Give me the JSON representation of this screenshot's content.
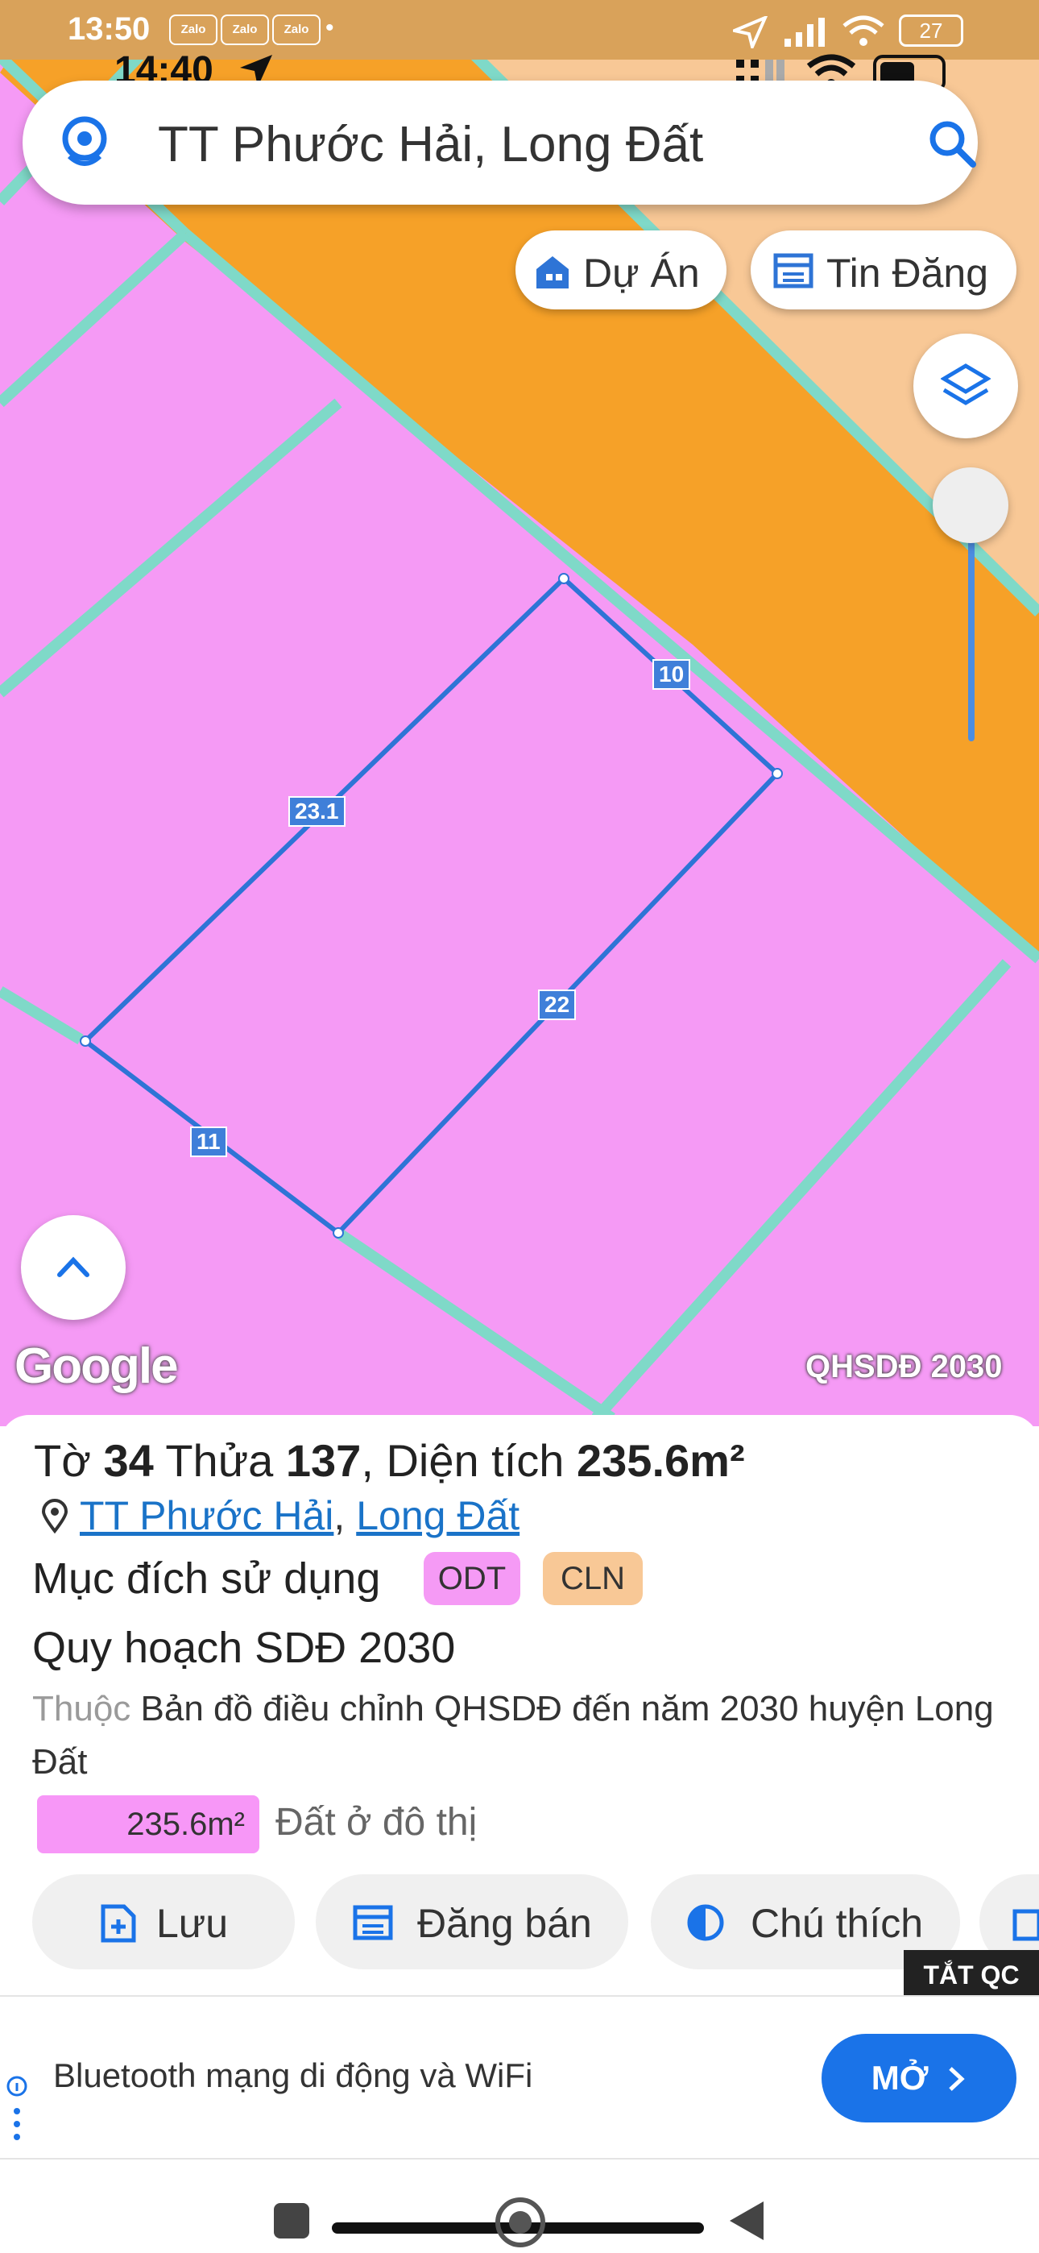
{
  "status_outer": {
    "time": "13:50",
    "zalo_labels": [
      "Zalo",
      "Zalo",
      "Zalo"
    ],
    "battery": "27"
  },
  "status_inner": {
    "time": "14:40"
  },
  "search": {
    "text": "TT Phước Hải, Long Đất"
  },
  "chips": {
    "du_an": "Dự Án",
    "tin_dang": "Tin Đăng"
  },
  "map": {
    "edge_labels": [
      "10",
      "23.1",
      "22",
      "11"
    ],
    "google": "Google",
    "layer_name": "QHSDĐ 2030",
    "colors": {
      "residential": "#f59af5",
      "perennial": "#f6a128",
      "road": "#7fd9c8",
      "parcel": "#2e74d6",
      "peach": "#f8c896"
    }
  },
  "parcel": {
    "to_label": "Tờ",
    "to_value": "34",
    "thua_label": "Thửa",
    "thua_value": "137",
    "area_label": "Diện tích",
    "area_value": "235.6m²",
    "location_a": "TT Phước Hải",
    "location_sep": ",",
    "location_b": "Long Đất",
    "purpose_label": "Mục đích sử dụng",
    "badges": [
      {
        "text": "ODT",
        "color": "#f59af5"
      },
      {
        "text": "CLN",
        "color": "#f8c896"
      }
    ],
    "plan": "Quy hoạch SDĐ 2030",
    "belongs_prefix": "Thuộc",
    "belongs_text": "Bản đồ điều chỉnh QHSDĐ đến năm 2030 huyện Long Đất",
    "area_bar_value": "235.6m²",
    "area_bar_desc": "Đất ở đô thị"
  },
  "actions": {
    "luu": "Lưu",
    "dang_ban": "Đăng bán",
    "chu_thich": "Chú thích"
  },
  "ad": {
    "close": "TẮT QC",
    "text": "Bluetooth mạng di động và WiFi",
    "button": "MỞ"
  }
}
